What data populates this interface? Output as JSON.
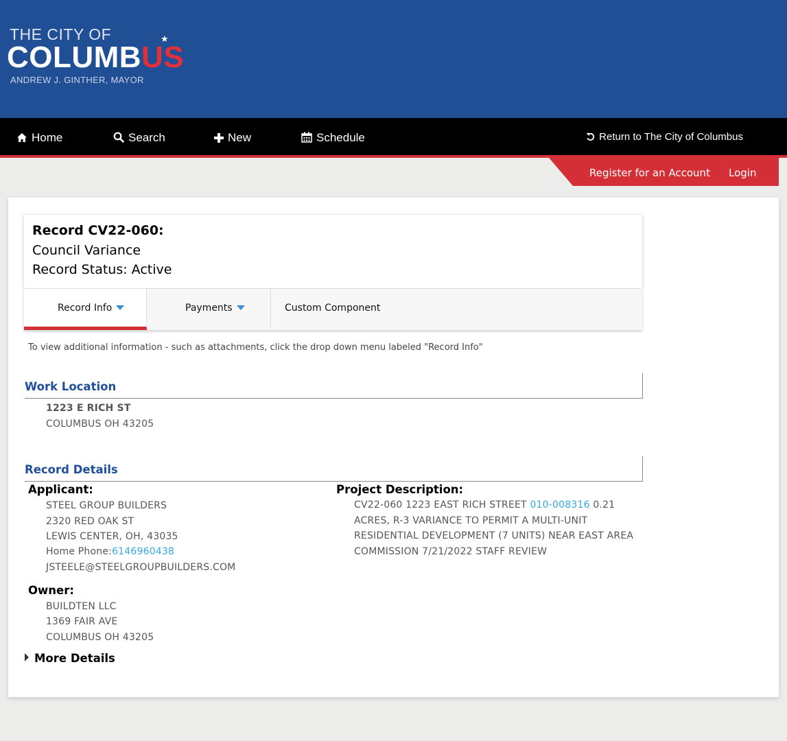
{
  "header": {
    "logo": {
      "line1": "THE CITY OF",
      "line2_main": "COLUMB",
      "line2_accent": "US",
      "line3": "ANDREW J. GINTHER, MAYOR"
    },
    "banner_color": "#214f96",
    "accent_color": "#d42f36"
  },
  "nav": {
    "items": [
      {
        "label": "Home",
        "icon": "home-icon"
      },
      {
        "label": "Search",
        "icon": "search-icon"
      },
      {
        "label": "New",
        "icon": "plus-icon"
      },
      {
        "label": "Schedule",
        "icon": "calendar-icon"
      }
    ],
    "return_label": "Return to The City of Columbus"
  },
  "account": {
    "register_label": "Register for an Account",
    "login_label": "Login"
  },
  "record": {
    "title": "Record CV22-060:",
    "type": "Council Variance",
    "status": "Record Status: Active"
  },
  "tabs": [
    {
      "label": "Record Info",
      "has_dropdown": true,
      "active": true
    },
    {
      "label": "Payments",
      "has_dropdown": true,
      "active": false
    },
    {
      "label": "Custom Component",
      "has_dropdown": false,
      "active": false
    }
  ],
  "hint": "To view additional information - such as attachments, click the drop down menu labeled \"Record Info\"",
  "work_location": {
    "title": "Work Location",
    "street": "1223 E RICH ST",
    "city": "COLUMBUS OH 43205"
  },
  "record_details": {
    "title": "Record Details",
    "applicant": {
      "label": "Applicant:",
      "name": "STEEL GROUP BUILDERS",
      "address1": "2320 RED OAK ST",
      "address2": "LEWIS CENTER, OH, 43035",
      "phone_label": "Home Phone:",
      "phone": "6146960438",
      "email": "JSTEELE@STEELGROUPBUILDERS.COM"
    },
    "owner": {
      "label": "Owner:",
      "name": "BUILDTEN LLC",
      "address1": "1369 FAIR AVE",
      "address2": "COLUMBUS OH 43205"
    },
    "project": {
      "label": "Project Description:",
      "text_before": "CV22-060 1223 EAST RICH STREET ",
      "parcel": "010-008316",
      "text_after": " 0.21 ACRES, R-3 VARIANCE TO PERMIT A MULTI-UNIT RESIDENTIAL DEVELOPMENT (7 UNITS) NEAR EAST AREA COMMISSION 7/21/2022 STAFF REVIEW"
    },
    "more_details": "More Details"
  }
}
